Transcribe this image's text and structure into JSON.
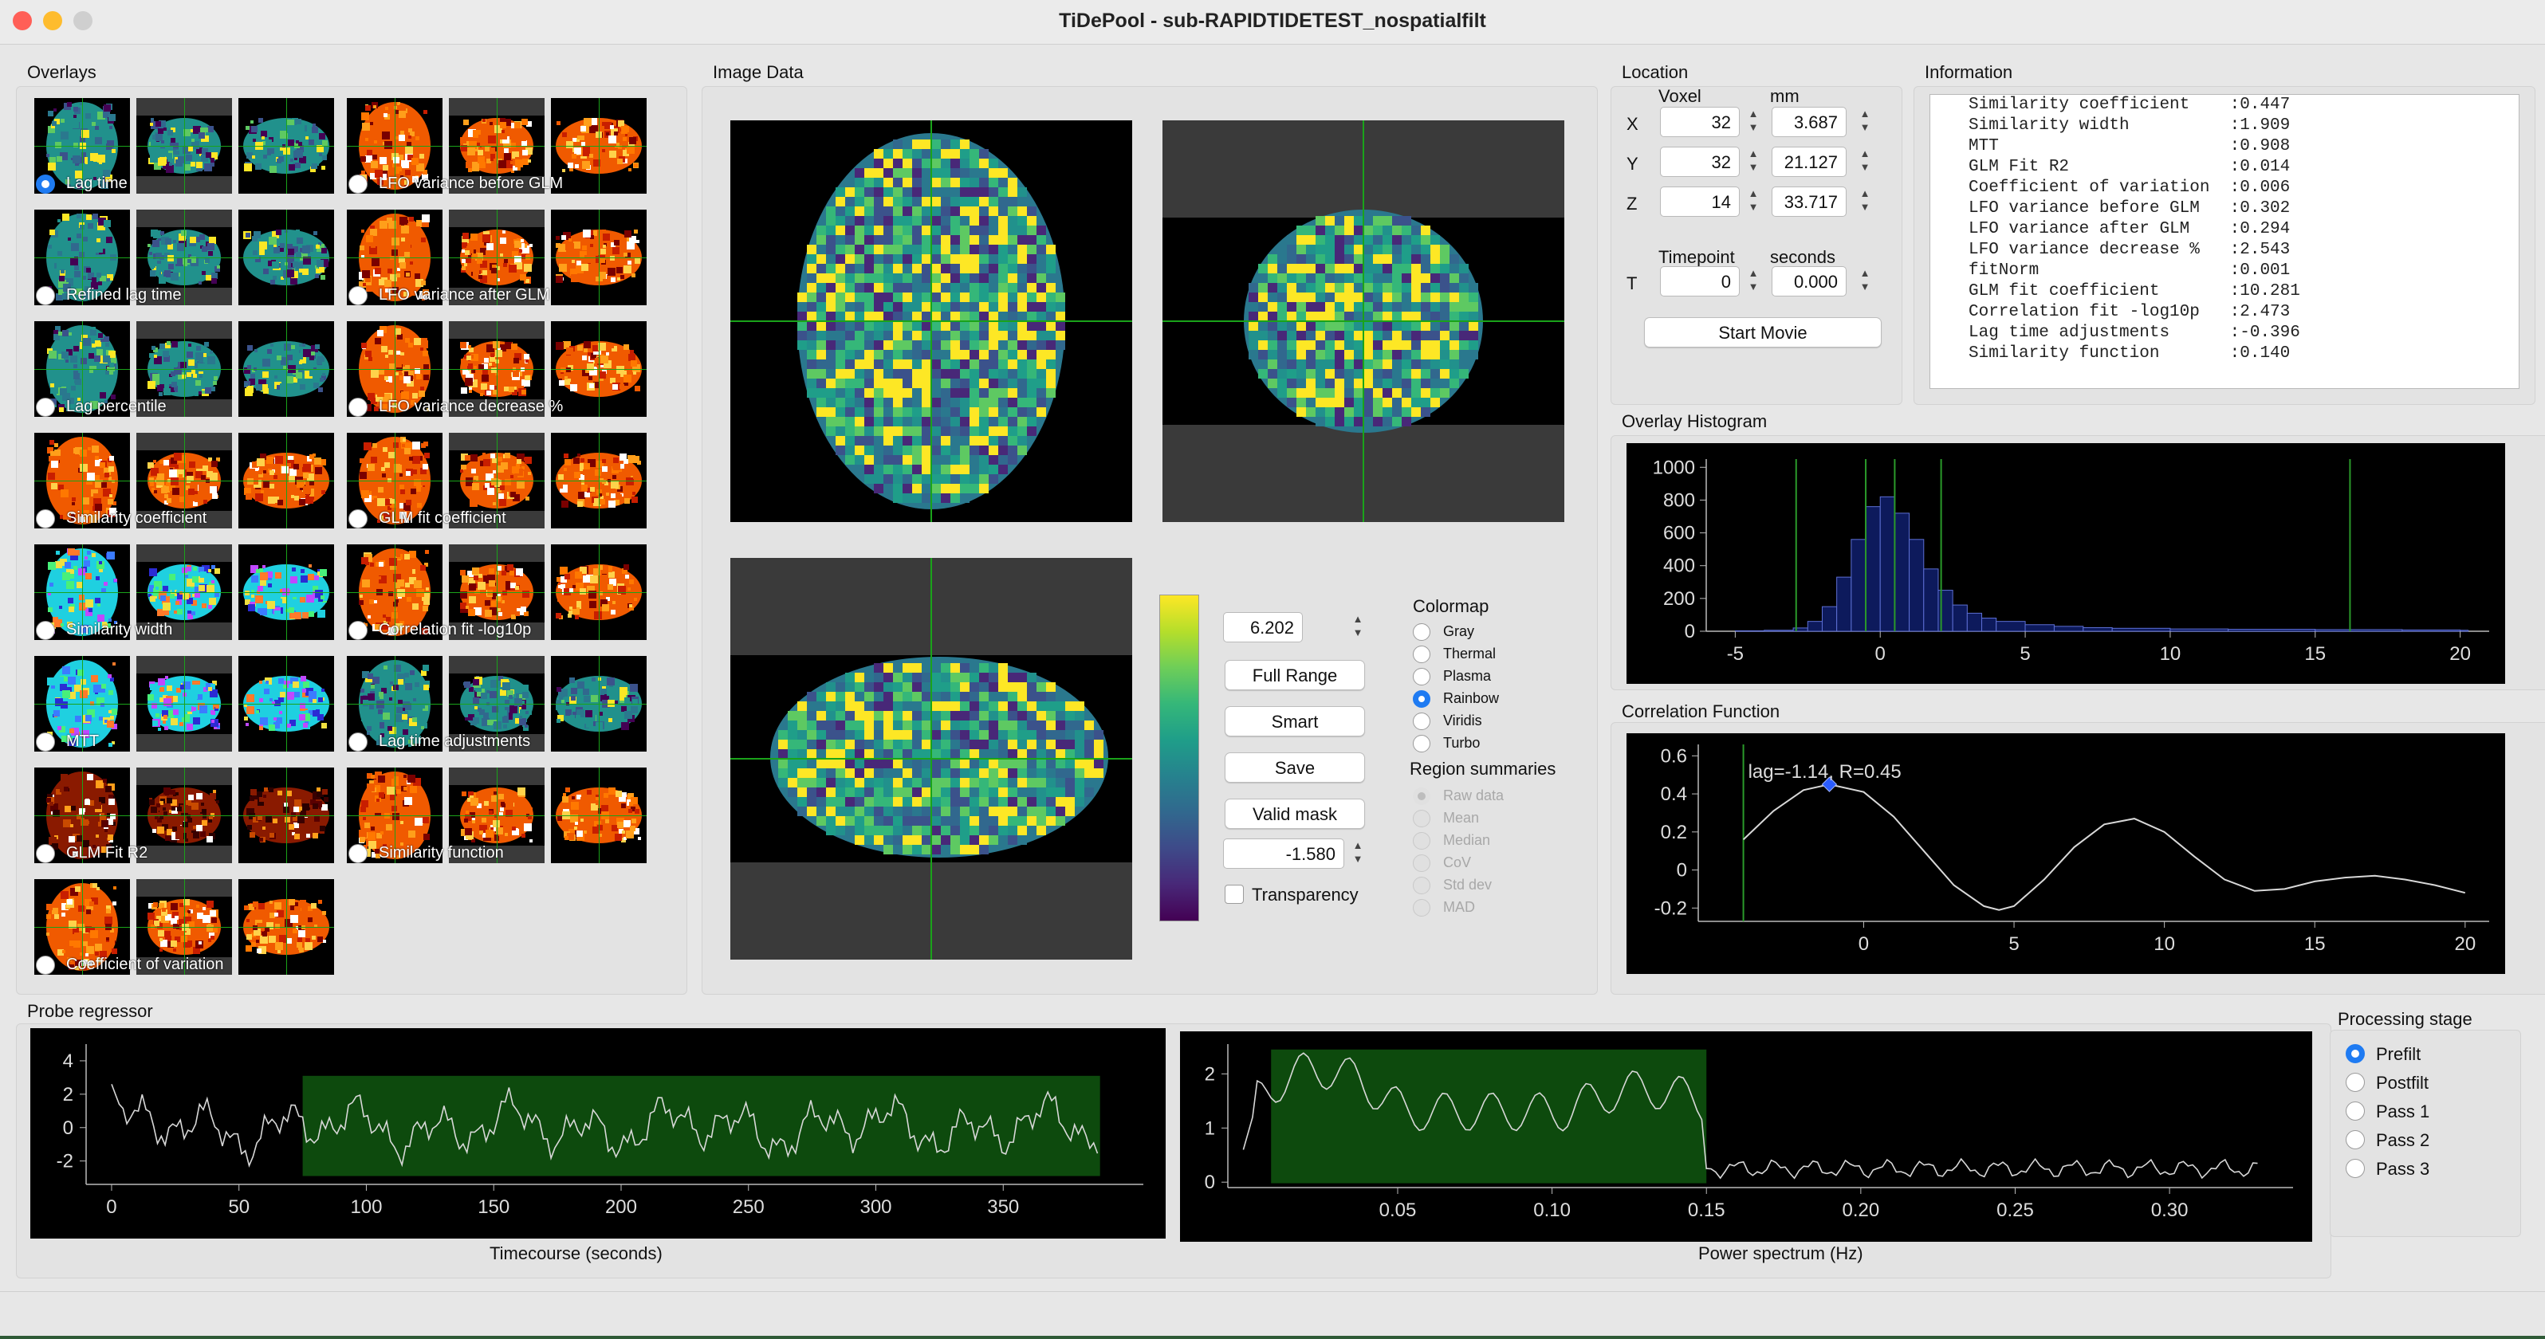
{
  "window": {
    "title": "TiDePool - sub-RAPIDTIDETEST_nospatialfilt"
  },
  "overlays": {
    "heading": "Overlays",
    "items": [
      {
        "label": "Lag time",
        "selected": true,
        "cmap": "viridis"
      },
      {
        "label": "LFO variance before GLM",
        "selected": false,
        "cmap": "hot"
      },
      {
        "label": "Refined lag time",
        "selected": false,
        "cmap": "viridis"
      },
      {
        "label": "LFO variance after GLM",
        "selected": false,
        "cmap": "hot"
      },
      {
        "label": "Lag percentile",
        "selected": false,
        "cmap": "viridis"
      },
      {
        "label": "LFO variance decrease %",
        "selected": false,
        "cmap": "hot"
      },
      {
        "label": "Similarity coefficient",
        "selected": false,
        "cmap": "hot"
      },
      {
        "label": "GLM fit coefficient",
        "selected": false,
        "cmap": "hot"
      },
      {
        "label": "Similarity width",
        "selected": false,
        "cmap": "rainbow"
      },
      {
        "label": "Correlation fit -log10p",
        "selected": false,
        "cmap": "hot"
      },
      {
        "label": "MTT",
        "selected": false,
        "cmap": "rainbow"
      },
      {
        "label": "Lag time adjustments",
        "selected": false,
        "cmap": "viridis"
      },
      {
        "label": "GLM Fit R2",
        "selected": false,
        "cmap": "darkhot"
      },
      {
        "label": "Similarity function",
        "selected": false,
        "cmap": "hot"
      },
      {
        "label": "Coefficient of variation",
        "selected": false,
        "cmap": "hot"
      }
    ]
  },
  "image_data": {
    "heading": "Image Data",
    "range_max": "6.202",
    "range_min": "-1.580",
    "buttons": {
      "full_range": "Full Range",
      "smart": "Smart",
      "save": "Save",
      "valid_mask": "Valid mask"
    },
    "transparency_label": "Transparency",
    "colormap": {
      "heading": "Colormap",
      "options": [
        "Gray",
        "Thermal",
        "Plasma",
        "Rainbow",
        "Viridis",
        "Turbo"
      ],
      "selected": "Rainbow"
    },
    "region_summaries": {
      "heading": "Region summaries",
      "options": [
        "Raw data",
        "Mean",
        "Median",
        "CoV",
        "Std dev",
        "MAD"
      ],
      "selected": "Raw data"
    }
  },
  "location": {
    "heading": "Location",
    "voxel_label": "Voxel",
    "mm_label": "mm",
    "x": {
      "label": "X",
      "voxel": "32",
      "mm": "3.687"
    },
    "y": {
      "label": "Y",
      "voxel": "32",
      "mm": "21.127"
    },
    "z": {
      "label": "Z",
      "voxel": "14",
      "mm": "33.717"
    },
    "timepoint_label": "Timepoint",
    "seconds_label": "seconds",
    "t": {
      "label": "T",
      "timepoint": "0",
      "seconds": "0.000"
    },
    "start_movie": "Start Movie"
  },
  "information": {
    "heading": "Information",
    "lines": [
      "Similarity coefficient    :0.447",
      "Similarity width          :1.909",
      "MTT                       :0.908",
      "GLM Fit R2                :0.014",
      "Coefficient of variation  :0.006",
      "LFO variance before GLM   :0.302",
      "LFO variance after GLM    :0.294",
      "LFO variance decrease %   :2.543",
      "fitNorm                   :0.001",
      "GLM fit coefficient       :10.281",
      "Correlation fit -log10p   :2.473",
      "Lag time adjustments      :-0.396",
      "Similarity function       :0.140"
    ]
  },
  "histogram": {
    "heading": "Overlay Histogram",
    "chart_data": {
      "type": "bar",
      "xlim": [
        -6,
        21
      ],
      "ylim": [
        0,
        1050
      ],
      "xticks": [
        "-5",
        "0",
        "5",
        "10",
        "15",
        "20"
      ],
      "yticks": [
        "0",
        "200",
        "400",
        "600",
        "800",
        "1000"
      ],
      "x": [
        -5,
        -4,
        -3,
        -2.5,
        -2,
        -1.5,
        -1,
        -0.5,
        0,
        0.5,
        1,
        1.5,
        2,
        2.5,
        3,
        3.5,
        4,
        5,
        6,
        7,
        8,
        10,
        12,
        15,
        18,
        20
      ],
      "values": [
        3,
        6,
        20,
        60,
        150,
        330,
        560,
        760,
        820,
        720,
        560,
        380,
        250,
        160,
        110,
        80,
        60,
        40,
        30,
        22,
        18,
        14,
        12,
        10,
        8,
        6
      ],
      "markers": [
        -2.9,
        -0.5,
        0.5,
        2.1,
        16.2
      ]
    }
  },
  "correlation": {
    "heading": "Correlation Function",
    "annotation": "lag=-1.14, R=0.45",
    "chart_data": {
      "type": "line",
      "xlim": [
        -5.5,
        20.8
      ],
      "ylim": [
        -0.27,
        0.66
      ],
      "xticks": [
        "0",
        "5",
        "10",
        "15",
        "20"
      ],
      "yticks": [
        "0.6",
        "0.4",
        "0.2",
        "0",
        "-0.2"
      ],
      "x": [
        -4,
        -3,
        -2,
        -1.14,
        0,
        1,
        2,
        3,
        4,
        4.5,
        5,
        6,
        7,
        8,
        9,
        10,
        11,
        12,
        13,
        14,
        15,
        16,
        17,
        18,
        19,
        20
      ],
      "y": [
        0.16,
        0.31,
        0.42,
        0.45,
        0.41,
        0.28,
        0.1,
        -0.08,
        -0.19,
        -0.21,
        -0.19,
        -0.05,
        0.12,
        0.24,
        0.27,
        0.2,
        0.07,
        -0.05,
        -0.11,
        -0.1,
        -0.06,
        -0.04,
        -0.03,
        -0.05,
        -0.08,
        -0.12
      ],
      "peak": [
        -1.14,
        0.45
      ],
      "marker_x": -4
    }
  },
  "probe": {
    "heading": "Probe regressor",
    "timecourse_label": "Timecourse (seconds)",
    "power_label": "Power spectrum (Hz)",
    "timecourse": {
      "type": "line",
      "xlim": [
        -10,
        405
      ],
      "ylim": [
        -3.4,
        5
      ],
      "xticks": [
        "0",
        "50",
        "100",
        "150",
        "200",
        "250",
        "300",
        "350"
      ],
      "yticks": [
        "4",
        "2",
        "0",
        "-2"
      ],
      "window": [
        75,
        388
      ]
    },
    "spectrum": {
      "type": "line",
      "xlim": [
        -0.005,
        0.34
      ],
      "ylim": [
        -0.1,
        2.55
      ],
      "xticks": [
        "0.05",
        "0.10",
        "0.15",
        "0.20",
        "0.25",
        "0.30"
      ],
      "yticks": [
        "2",
        "1",
        "0"
      ],
      "window": [
        0.009,
        0.15
      ]
    }
  },
  "processing": {
    "heading": "Processing stage",
    "options": [
      "Prefilt",
      "Postfilt",
      "Pass 1",
      "Pass 2",
      "Pass 3"
    ],
    "selected": "Prefilt"
  },
  "colors": {
    "accent": "#1f7bf2",
    "plot_line": "#d8d8d8",
    "hist_fill": "#0d1a5c",
    "grid_marker": "#2a9a2a",
    "window_fill": "#0d4a0d"
  }
}
